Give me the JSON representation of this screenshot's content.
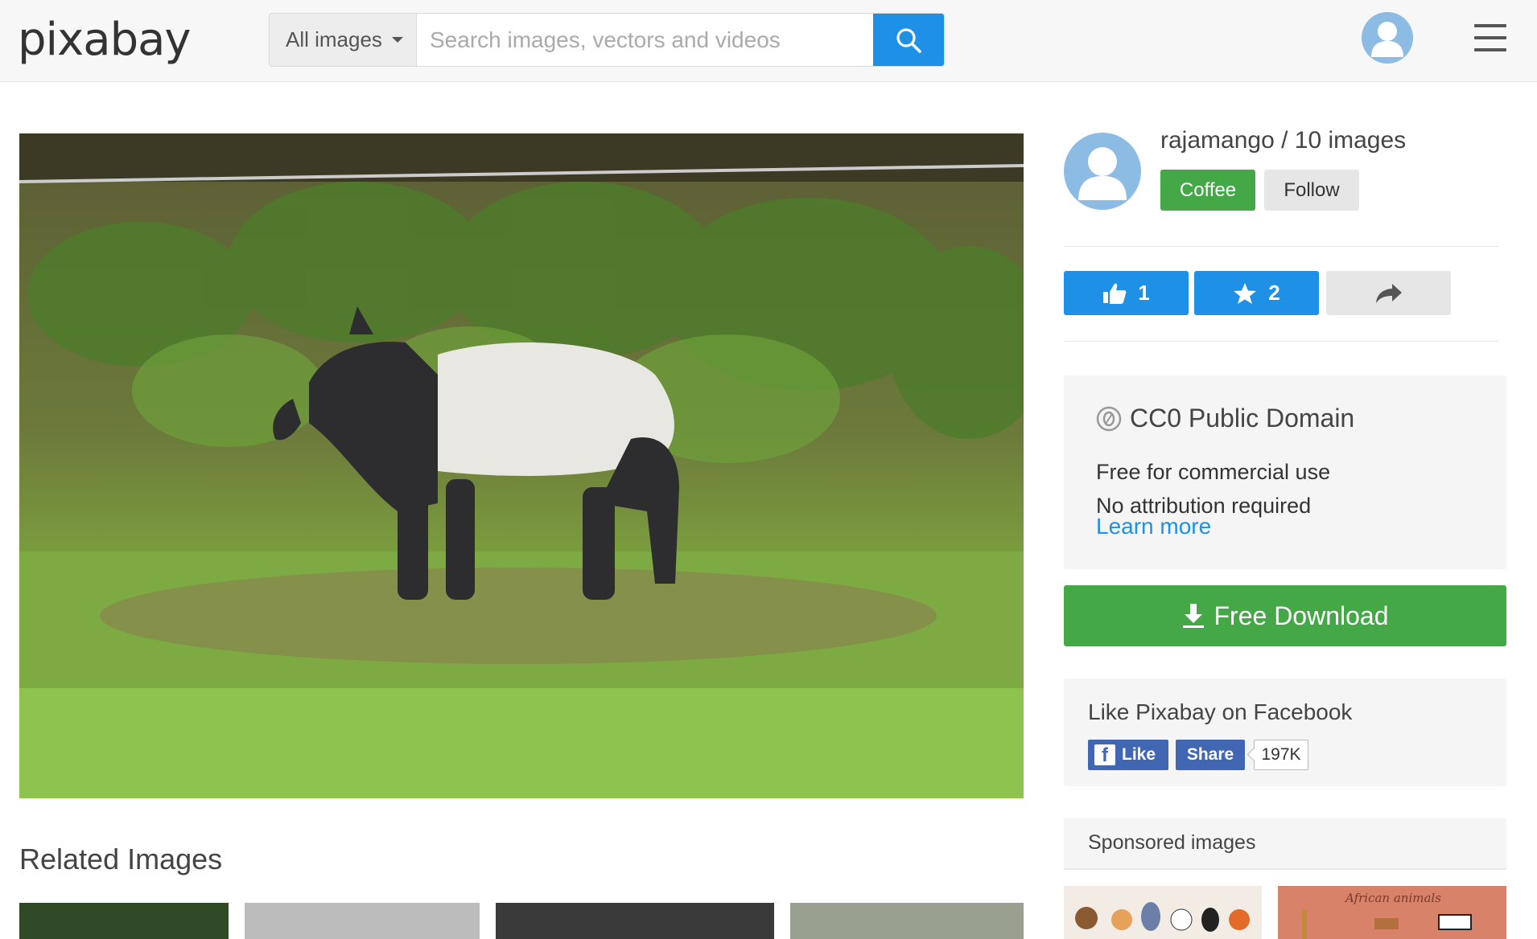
{
  "header": {
    "logo": "pixabay",
    "category": "All images",
    "search_placeholder": "Search images, vectors and videos"
  },
  "author": {
    "line": "rajamango / 10 images",
    "coffee_label": "Coffee",
    "follow_label": "Follow"
  },
  "actions": {
    "likes": "1",
    "favorites": "2"
  },
  "license": {
    "title": "CC0 Public Domain",
    "line1": "Free for commercial use",
    "line2": "No attribution required",
    "link": "Learn more"
  },
  "download_label": "Free Download",
  "facebook": {
    "title": "Like Pixabay on Facebook",
    "like_label": "Like",
    "share_label": "Share",
    "count": "197K"
  },
  "related_title": "Related Images",
  "sponsored_title": "Sponsored images",
  "sponsored_thumb_text": "African animals",
  "colors": {
    "accent_blue": "#1e90e5",
    "green": "#44a847",
    "facebook_blue": "#4267b2"
  }
}
